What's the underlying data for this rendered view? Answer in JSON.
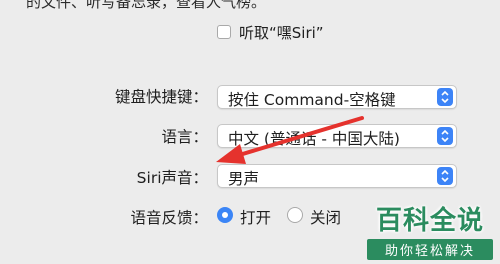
{
  "top_text": "的文件、听写备忘录，查看人气榜。",
  "hey_siri": {
    "label": "听取“嘿Siri”",
    "checked": false
  },
  "keyboard_shortcut": {
    "label": "键盘快捷键：",
    "value": "按住 Command-空格键"
  },
  "language": {
    "label": "语言：",
    "value": "中文 (普通话 - 中国大陆)"
  },
  "siri_voice": {
    "label": "Siri声音：",
    "value": "男声"
  },
  "voice_feedback": {
    "label": "语音反馈：",
    "options": [
      {
        "label": "打开",
        "selected": true
      },
      {
        "label": "关闭",
        "selected": false
      }
    ]
  },
  "watermark": {
    "title": "百科全说",
    "subtitle": "助你轻松解决"
  },
  "colors": {
    "accent": "#3b85f6",
    "arrow": "#e5322d",
    "watermark": "#2b8c5f"
  },
  "icons": {
    "stepper": "up-down-chevron-icon",
    "annotation": "red-arrow"
  }
}
